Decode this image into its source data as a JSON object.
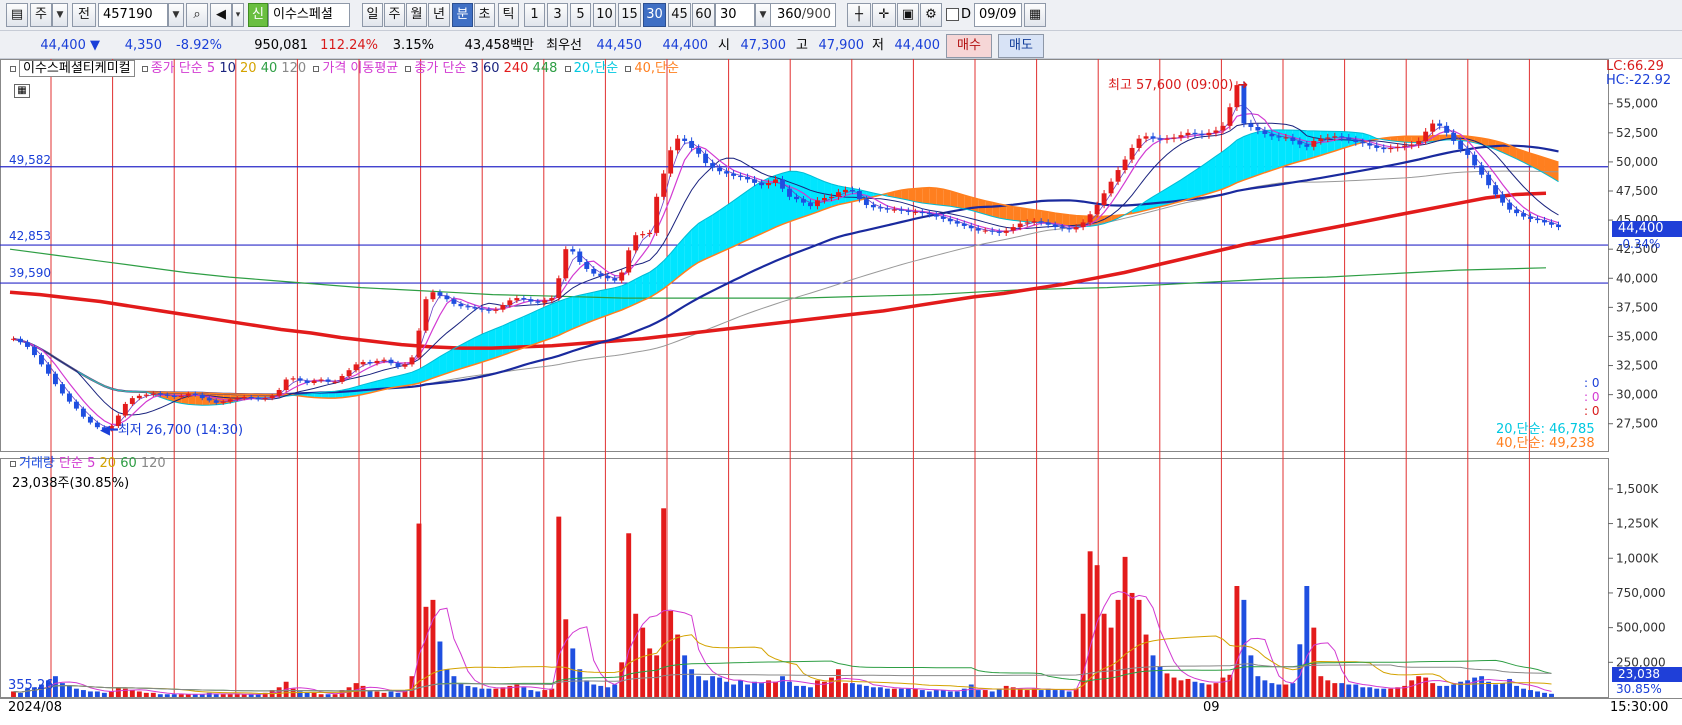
{
  "toolbar": {
    "period_prefix": "주",
    "prev_label": "전",
    "stock_code": "457190",
    "new_badge": "신",
    "stock_name": "이수스페셜",
    "period_buttons": [
      "일",
      "주",
      "월",
      "년",
      "분",
      "초",
      "틱"
    ],
    "selected_period": "분",
    "interval_buttons": [
      "1",
      "3",
      "5",
      "10",
      "15",
      "30",
      "45",
      "60"
    ],
    "selected_interval": "30",
    "interval_value": "30",
    "count_value": "360",
    "count_total": "/900",
    "d_label": "D",
    "date_value": "09/09",
    "icons": [
      "screen-icon",
      "search-icon",
      "speaker-icon",
      "candle-icon",
      "crosshair-icon",
      "save-icon",
      "gear-icon",
      "calendar-icon"
    ]
  },
  "quote": {
    "price": "44,400",
    "change_arrow": "▼",
    "change": "4,350",
    "change_pct": "-8.92%",
    "volume": "950,081",
    "volume_ratio": "112.24%",
    "turnover": "3.15%",
    "amount": "43,458백만",
    "best_ask_label": "최우선",
    "best_ask": "44,450",
    "best_bid": "44,400",
    "open_label": "시",
    "open": "47,300",
    "high_label": "고",
    "high": "47,900",
    "low_label": "저",
    "low": "44,400",
    "buy_label": "매수",
    "sell_label": "매도"
  },
  "legend": {
    "name": "이수스페셜티케미컬",
    "close_simple_label": "종가 단순",
    "ma_periods": [
      "5",
      "10",
      "20",
      "40",
      "120"
    ],
    "price_ma_label": "가격 이동평균",
    "close_simple_label2": "종가 단순",
    "ma_periods2": [
      "3",
      "60",
      "240",
      "448"
    ],
    "ma20_label": "20,단순",
    "ma40_label": "40,단순"
  },
  "annotations": {
    "high_label": "최고 57,600 (09:00)",
    "low_label": "최저 26,700 (14:30)",
    "line_49582": "49,582",
    "line_42853": "42,853",
    "line_39590": "39,590",
    "lc": "LC:66.29",
    "hc": "HC:-22.92",
    "current_price": "44,400",
    "current_pct": "-0.34%",
    "zero_vals": [
      ": 0",
      ": 0",
      ": 0"
    ],
    "ma20_value": "20,단순: 46,785",
    "ma40_value": "40,단순: 49,238"
  },
  "volume_panel": {
    "title": "거래량",
    "simple_label": "단순",
    "periods": [
      "5",
      "20",
      "60",
      "120"
    ],
    "last_volume": "23,038주(30.85%)",
    "left_marker": "355,26",
    "current_volume": "23,038",
    "current_pct": "30.85%"
  },
  "x_axis": {
    "start_label": "2024/08",
    "month_label": "09",
    "time_label": "15:30:00"
  },
  "colors": {
    "ma5": "#d23ad2",
    "ma10": "#1a237e",
    "ma20": "#00e5ff",
    "ma40": "#ff7f1f",
    "ma120": "#999999",
    "ma240": "#e21b1b",
    "ma448": "#2e9e44",
    "up": "#e31b1b",
    "down": "#1f4fe0"
  },
  "chart_data": {
    "type": "candlestick",
    "y_axis_ticks": [
      "55,000",
      "52,500",
      "50,000",
      "47,500",
      "45,000",
      "42,500",
      "40,000",
      "37,500",
      "35,000",
      "32,500",
      "30,000",
      "27,500"
    ],
    "ylim": [
      25500,
      58500
    ],
    "volume_ticks": [
      "1,500K",
      "1,250K",
      "1,000K",
      "750,000",
      "500,000",
      "250,000"
    ],
    "volume_ylim": [
      0,
      1600000
    ],
    "close_series": [
      34800,
      34500,
      34100,
      33400,
      32600,
      31800,
      30900,
      30100,
      29400,
      28800,
      28100,
      27600,
      27200,
      27000,
      27300,
      28200,
      29200,
      29700,
      29900,
      30000,
      30100,
      30000,
      29900,
      29800,
      29900,
      30100,
      30000,
      29700,
      29500,
      29300,
      29400,
      29600,
      29700,
      29800,
      29700,
      29600,
      29700,
      29900,
      30400,
      31300,
      31400,
      31200,
      31000,
      31200,
      31300,
      31100,
      31100,
      31600,
      32100,
      32600,
      32800,
      32700,
      32900,
      33000,
      32700,
      32400,
      32600,
      33200,
      35500,
      38200,
      38800,
      38500,
      38200,
      37800,
      37600,
      37500,
      37400,
      37300,
      37200,
      37300,
      37700,
      38100,
      38300,
      38200,
      38000,
      37900,
      38100,
      38300,
      40000,
      42500,
      42300,
      41400,
      40800,
      40400,
      40200,
      40000,
      39800,
      40500,
      42400,
      43700,
      43800,
      43900,
      47000,
      49000,
      51000,
      52000,
      51800,
      51200,
      50700,
      49900,
      49500,
      49200,
      49000,
      48800,
      48700,
      48500,
      48200,
      48000,
      48200,
      48500,
      47700,
      47000,
      46800,
      46500,
      46200,
      46700,
      46900,
      47000,
      47400,
      47600,
      47500,
      46800,
      46300,
      46100,
      46000,
      45900,
      45900,
      45800,
      45700,
      45700,
      45600,
      45500,
      45300,
      45100,
      44900,
      44700,
      44500,
      44300,
      44100,
      44100,
      44000,
      43900,
      44100,
      44400,
      44700,
      44800,
      44900,
      44800,
      44600,
      44400,
      44300,
      44200,
      44400,
      44800,
      45500,
      46300,
      47300,
      48300,
      49300,
      50200,
      51200,
      52000,
      52200,
      52000,
      51900,
      52000,
      52100,
      52300,
      52500,
      52400,
      52300,
      52500,
      52700,
      53100,
      54700,
      56600,
      53300,
      53000,
      52700,
      52400,
      52200,
      52100,
      52100,
      51800,
      51500,
      51300,
      51800,
      52000,
      52100,
      52200,
      52100,
      51900,
      51700,
      51600,
      51400,
      51200,
      51100,
      51200,
      51300,
      51400,
      51500,
      51800,
      52600,
      53300,
      53100,
      52500,
      51800,
      51100,
      50600,
      49700,
      48900,
      48000,
      47200,
      46500,
      45900,
      45600,
      45300,
      45100,
      45000,
      44800,
      44600,
      44400
    ],
    "volume_series": [
      40000,
      30000,
      60000,
      70000,
      90000,
      120000,
      150000,
      100000,
      80000,
      60000,
      50000,
      40000,
      40000,
      30000,
      40000,
      70000,
      60000,
      50000,
      40000,
      30000,
      30000,
      20000,
      20000,
      20000,
      20000,
      20000,
      20000,
      20000,
      30000,
      20000,
      20000,
      20000,
      20000,
      20000,
      20000,
      20000,
      30000,
      50000,
      70000,
      110000,
      60000,
      40000,
      30000,
      30000,
      20000,
      20000,
      20000,
      50000,
      70000,
      100000,
      80000,
      50000,
      40000,
      30000,
      40000,
      30000,
      50000,
      150000,
      1250000,
      650000,
      700000,
      400000,
      200000,
      150000,
      100000,
      80000,
      70000,
      60000,
      60000,
      60000,
      70000,
      80000,
      90000,
      70000,
      50000,
      40000,
      50000,
      60000,
      1300000,
      560000,
      350000,
      200000,
      120000,
      90000,
      80000,
      70000,
      90000,
      250000,
      1180000,
      600000,
      500000,
      350000,
      300000,
      1360000,
      620000,
      450000,
      300000,
      200000,
      150000,
      120000,
      150000,
      140000,
      110000,
      90000,
      120000,
      90000,
      110000,
      100000,
      120000,
      110000,
      150000,
      110000,
      80000,
      80000,
      70000,
      120000,
      110000,
      140000,
      200000,
      100000,
      100000,
      90000,
      80000,
      70000,
      70000,
      60000,
      60000,
      60000,
      60000,
      60000,
      50000,
      40000,
      50000,
      50000,
      40000,
      40000,
      60000,
      90000,
      50000,
      50000,
      40000,
      60000,
      80000,
      70000,
      60000,
      50000,
      60000,
      50000,
      60000,
      50000,
      50000,
      40000,
      60000,
      600000,
      1050000,
      950000,
      600000,
      500000,
      700000,
      1010000,
      750000,
      700000,
      450000,
      300000,
      220000,
      170000,
      140000,
      120000,
      130000,
      110000,
      100000,
      90000,
      100000,
      140000,
      160000,
      800000,
      700000,
      300000,
      150000,
      120000,
      100000,
      90000,
      90000,
      100000,
      380000,
      800000,
      500000,
      150000,
      120000,
      100000,
      100000,
      90000,
      90000,
      70000,
      70000,
      60000,
      60000,
      60000,
      70000,
      80000,
      120000,
      150000,
      140000,
      100000,
      80000,
      80000,
      90000,
      110000,
      120000,
      140000,
      150000,
      110000,
      90000,
      100000,
      130000,
      80000,
      60000,
      50000,
      40000,
      30000,
      23038
    ],
    "ma240_series": [
      38800,
      38600,
      38300,
      38000,
      37600,
      37200,
      36800,
      36400,
      36000,
      35600,
      35300,
      34900,
      34600,
      34300,
      34100,
      34000,
      34000,
      34100,
      34200,
      34400,
      34600,
      34800,
      35100,
      35400,
      35700,
      36000,
      36300,
      36600,
      36900,
      37200,
      37600,
      38000,
      38400,
      38700,
      39100,
      39500,
      40000,
      40500,
      41100,
      41700,
      42300,
      42900,
      43400,
      43900,
      44400,
      44900,
      45400,
      45900,
      46400,
      46900,
      47200,
      47300
    ],
    "ma448_series": [
      42500,
      42000,
      41500,
      41000,
      40500,
      40100,
      39800,
      39500,
      39200,
      39000,
      38800,
      38600,
      38500,
      38400,
      38300,
      38300,
      38300,
      38300,
      38300,
      38400,
      38500,
      38600,
      38800,
      39000,
      39100,
      39200,
      39400,
      39600,
      39800,
      40000,
      40100,
      40300,
      40500,
      40700,
      40800,
      40900
    ]
  }
}
